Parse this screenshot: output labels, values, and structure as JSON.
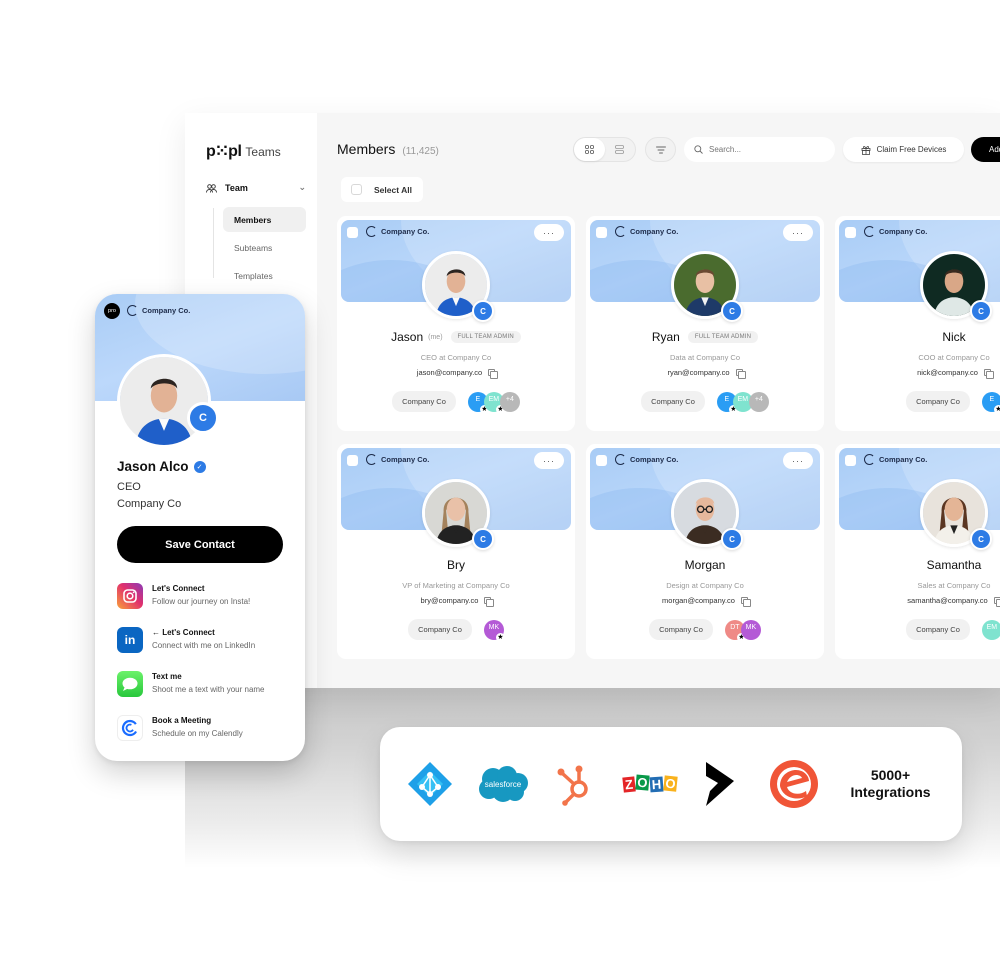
{
  "sidebar": {
    "brand": "p⁙pl",
    "brand_suffix": "Teams",
    "team_label": "Team",
    "items": [
      {
        "label": "Members",
        "active": true
      },
      {
        "label": "Subteams",
        "active": false
      },
      {
        "label": "Templates",
        "active": false
      }
    ]
  },
  "header": {
    "title": "Members",
    "count": "(11,425)",
    "view_modes": [
      "grid-view",
      "list-view"
    ],
    "active_view": "grid-view",
    "search_placeholder": "Search...",
    "claim_label": "Claim Free Devices",
    "add_label": "Add"
  },
  "select_all_label": "Select All",
  "members": [
    {
      "company": "Company Co.",
      "name": "Jason",
      "me": "(me)",
      "role_badge": "FULL TEAM ADMIN",
      "title": "CEO at Company Co",
      "email": "jason@company.co",
      "company_pill": "Company Co",
      "team_avatars": [
        {
          "initials": "E",
          "color": "#2a9df4",
          "star": true
        },
        {
          "initials": "EM",
          "color": "#7fe3cf",
          "star": true
        },
        {
          "initials": "+4",
          "color": "#b8b8b8",
          "star": false
        }
      ]
    },
    {
      "company": "Company Co.",
      "name": "Ryan",
      "me": "",
      "role_badge": "FULL TEAM ADMIN",
      "title": "Data at Company Co",
      "email": "ryan@company.co",
      "company_pill": "Company Co",
      "team_avatars": [
        {
          "initials": "E",
          "color": "#2a9df4",
          "star": true
        },
        {
          "initials": "EM",
          "color": "#7fe3cf",
          "star": false
        },
        {
          "initials": "+4",
          "color": "#b8b8b8",
          "star": false
        }
      ]
    },
    {
      "company": "Company Co.",
      "name": "Nick",
      "me": "",
      "role_badge": "",
      "title": "COO at Company Co",
      "email": "nick@company.co",
      "company_pill": "Company Co",
      "team_avatars": [
        {
          "initials": "E",
          "color": "#2a9df4",
          "star": true
        }
      ]
    },
    {
      "company": "Company Co.",
      "name": "Bry",
      "me": "",
      "role_badge": "",
      "title": "VP of Marketing at Company Co",
      "email": "bry@company.co",
      "company_pill": "Company Co",
      "team_avatars": [
        {
          "initials": "MK",
          "color": "#b45ad6",
          "star": true
        }
      ]
    },
    {
      "company": "Company Co.",
      "name": "Morgan",
      "me": "",
      "role_badge": "",
      "title": "Design at Company Co",
      "email": "morgan@company.co",
      "company_pill": "Company Co",
      "team_avatars": [
        {
          "initials": "DT",
          "color": "#ef8a86",
          "star": true
        },
        {
          "initials": "MK",
          "color": "#b45ad6",
          "star": false
        }
      ]
    },
    {
      "company": "Company Co.",
      "name": "Samantha",
      "me": "",
      "role_badge": "",
      "title": "Sales at Company Co",
      "email": "samantha@company.co",
      "company_pill": "Company Co",
      "team_avatars": [
        {
          "initials": "EM",
          "color": "#7fe3cf",
          "star": false
        }
      ]
    }
  ],
  "phone": {
    "pro_label": "pro",
    "company": "Company Co.",
    "name": "Jason Alco",
    "role": "CEO",
    "company_line": "Company Co",
    "save_label": "Save Contact",
    "links": [
      {
        "icon": "instagram-icon",
        "title": "Let's Connect",
        "subtitle": "Follow our journey on Insta!"
      },
      {
        "icon": "linkedin-icon",
        "title": "← Let's Connect",
        "subtitle": "Connect with me on LinkedIn"
      },
      {
        "icon": "messages-icon",
        "title": "Text me",
        "subtitle": "Shoot me a text with your name"
      },
      {
        "icon": "calendly-icon",
        "title": "Book a Meeting",
        "subtitle": "Schedule on my Calendly"
      }
    ]
  },
  "integrations": {
    "logos": [
      "azure-ad-icon",
      "salesforce-icon",
      "hubspot-icon",
      "zoho-icon",
      "dynamics-icon",
      "eventbrite-icon"
    ],
    "salesforce_text": "salesforce",
    "zoho_letters": [
      "Z",
      "O",
      "H",
      "O"
    ],
    "count_label": "5000+",
    "label": "Integrations"
  },
  "colors": {
    "accent_blue": "#2d7be5",
    "banner_blue": "#a9ccf5",
    "primary_button": "#000000"
  }
}
